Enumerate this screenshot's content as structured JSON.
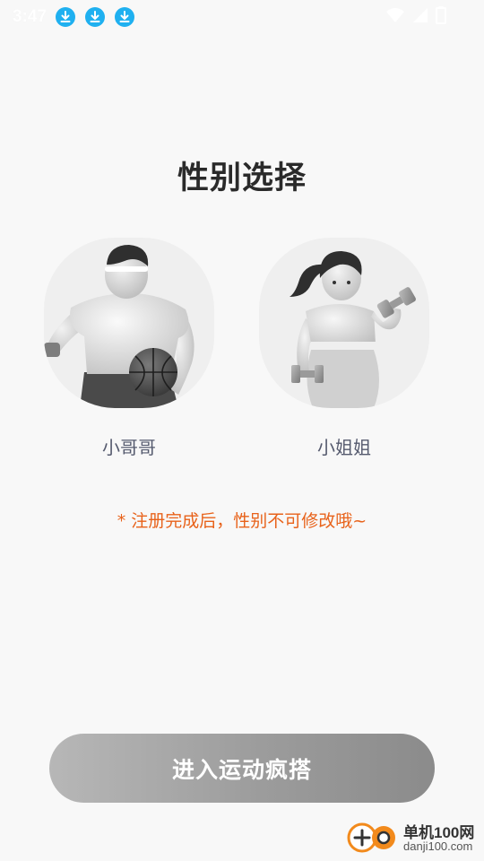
{
  "status_bar": {
    "time": "3:47",
    "notifications": [
      "download-icon",
      "download-icon",
      "download-icon"
    ],
    "accent_color": "#1fb0f0"
  },
  "title": "性别选择",
  "options": [
    {
      "id": "male",
      "label": "小哥哥",
      "image": "basketball-boy-illustration"
    },
    {
      "id": "female",
      "label": "小姐姐",
      "image": "dumbbell-girl-illustration"
    }
  ],
  "notice": "* 注册完成后，性别不可修改哦~",
  "notice_color": "#e8621a",
  "enter_button": {
    "label": "进入运动疯搭"
  },
  "watermark": {
    "title": "单机100网",
    "url": "danji100.com"
  }
}
